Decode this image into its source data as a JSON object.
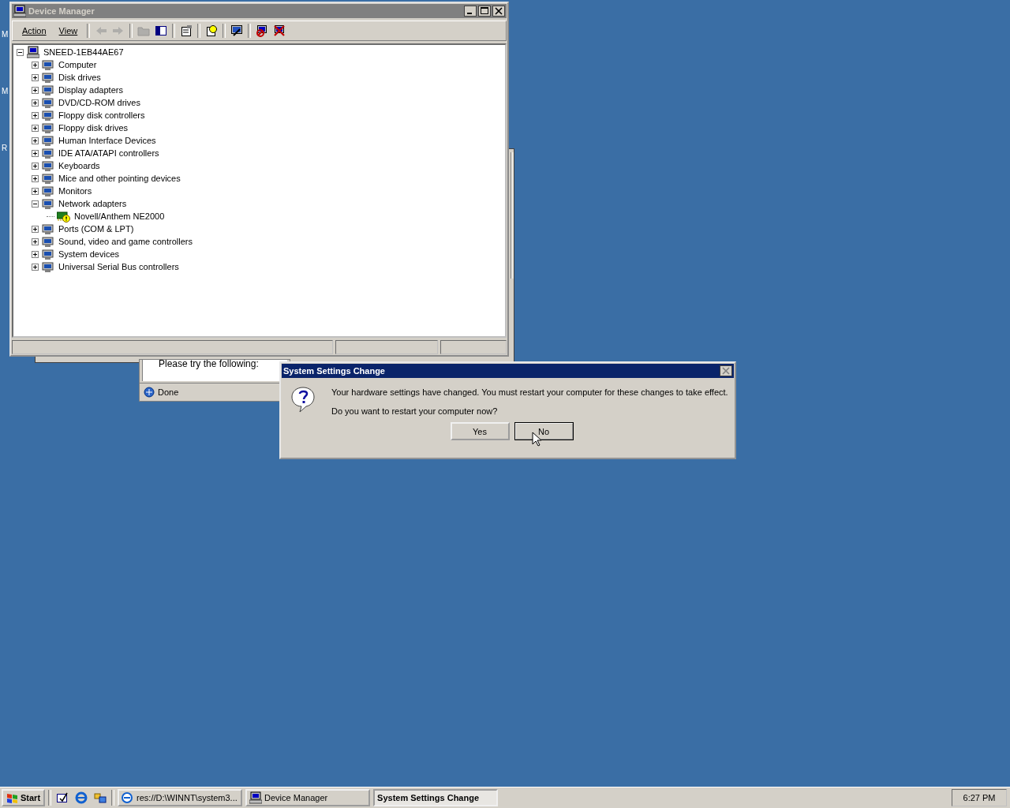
{
  "desktop": {
    "icon_labels": [
      "M",
      "M",
      "R"
    ]
  },
  "background_window": {
    "text": "Please try the following:",
    "status": "Done"
  },
  "device_manager": {
    "title": "Device Manager",
    "active": false,
    "menu": [
      "Action",
      "View"
    ],
    "toolbar_buttons": [
      {
        "disabled": true
      },
      {
        "disabled": true
      },
      {
        "disabled": true
      },
      {
        "disabled": false
      },
      {
        "disabled": false
      },
      {
        "disabled": false
      },
      {
        "disabled": false
      },
      {
        "disabled": false
      },
      {
        "disabled": false
      }
    ],
    "tree": {
      "label": "SNEED-1EB44AE67",
      "expanded": true,
      "children": [
        {
          "label": "Computer",
          "expanded": false
        },
        {
          "label": "Disk drives",
          "expanded": false
        },
        {
          "label": "Display adapters",
          "expanded": false
        },
        {
          "label": "DVD/CD-ROM drives",
          "expanded": false
        },
        {
          "label": "Floppy disk controllers",
          "expanded": false
        },
        {
          "label": "Floppy disk drives",
          "expanded": false
        },
        {
          "label": "Human Interface Devices",
          "expanded": false
        },
        {
          "label": "IDE ATA/ATAPI controllers",
          "expanded": false
        },
        {
          "label": "Keyboards",
          "expanded": false
        },
        {
          "label": "Mice and other pointing devices",
          "expanded": false
        },
        {
          "label": "Monitors",
          "expanded": false
        },
        {
          "label": "Network adapters",
          "expanded": true,
          "children": [
            {
              "label": "Novell/Anthem NE2000",
              "warning": true
            }
          ]
        },
        {
          "label": "Ports (COM & LPT)",
          "expanded": false
        },
        {
          "label": "Sound, video and game controllers",
          "expanded": false
        },
        {
          "label": "System devices",
          "expanded": false
        },
        {
          "label": "Universal Serial Bus controllers",
          "expanded": false
        }
      ]
    }
  },
  "dialog": {
    "title": "System Settings Change",
    "message": "Your hardware settings have changed. You must restart your computer for these changes to take effect.",
    "question": "Do you want to restart your computer now?",
    "buttons": [
      {
        "label": "Yes",
        "default": false
      },
      {
        "label": "No",
        "default": true
      }
    ]
  },
  "taskbar": {
    "start": "Start",
    "tasks": [
      {
        "label": "res://D:\\WINNT\\system3...",
        "selected": false
      },
      {
        "label": "Device Manager",
        "selected": false
      },
      {
        "label": "System Settings Change",
        "selected": true
      }
    ],
    "clock": "6:27 PM"
  }
}
